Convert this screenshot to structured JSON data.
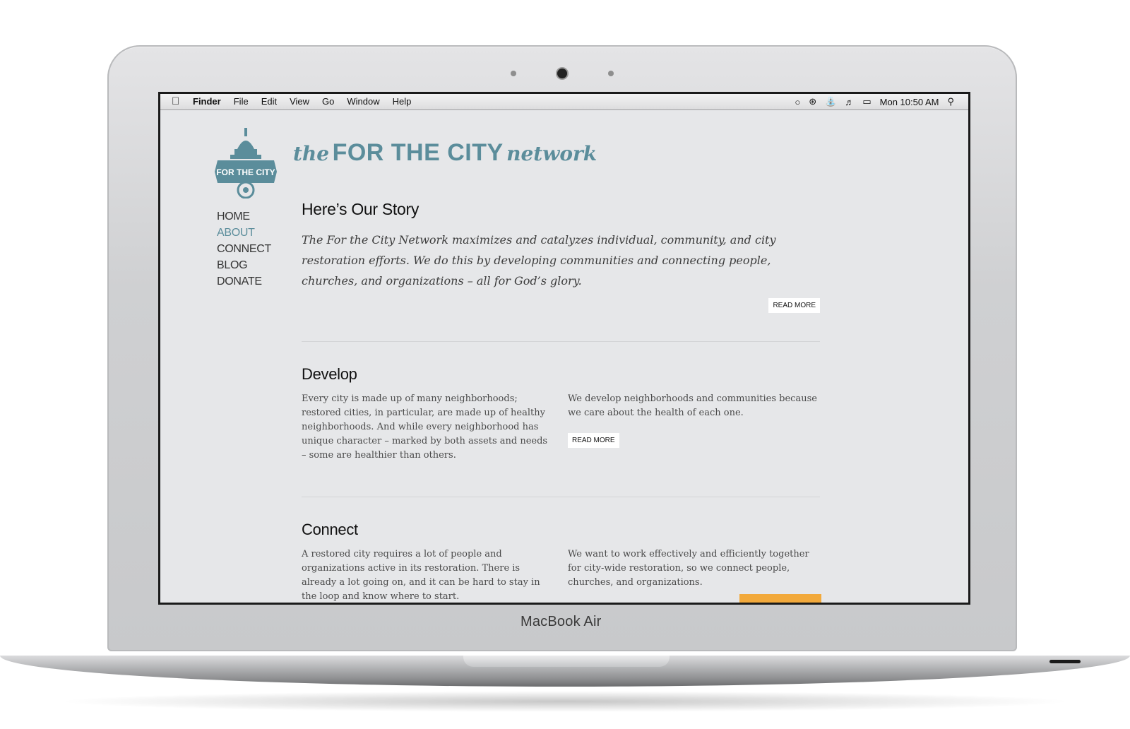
{
  "menubar": {
    "apple_icon": "apple-logo-icon",
    "items": [
      "Finder",
      "File",
      "Edit",
      "View",
      "Go",
      "Window",
      "Help"
    ],
    "clock": "Mon 10:50 AM",
    "status_icons": [
      "chat-bubble-icon",
      "bluetooth-icon",
      "wifi-icon",
      "volume-icon",
      "battery-icon",
      "spotlight-search-icon"
    ]
  },
  "logo": {
    "badge_text": "FOR THE CITY",
    "brand_the": "the",
    "brand_main": "FOR THE CITY",
    "brand_network": "network",
    "color": "#5b8d9b"
  },
  "nav": [
    "HOME",
    "ABOUT",
    "CONNECT",
    "BLOG",
    "DONATE"
  ],
  "nav_active": "ABOUT",
  "story": {
    "heading": "Here’s Our Story",
    "text": "The For the City Network maximizes and catalyzes individual, community, and city restoration efforts. We do this by developing communities and connecting people, churches, and organizations – all for God’s glory.",
    "button": "READ MORE"
  },
  "develop": {
    "heading": "Develop",
    "left": "Every city is made up of many neighborhoods; restored cities, in particular, are made up of healthy neighborhoods. And while every neighborhood has unique character – marked by both assets and needs – some are healthier than others.",
    "right": "We develop neighborhoods and communities because we care about the health of each one.",
    "button": "READ MORE"
  },
  "connect": {
    "heading": "Connect",
    "left": "A restored city requires a lot of people and organizations active in its restoration. There is already a lot going on, and it can be hard to stay in the loop and know where to start.",
    "right": "We want to work effectively and efficiently together for city-wide restoration, so we connect people, churches, and organizations.",
    "accent": "#f2a93b"
  },
  "device": {
    "label": "MacBook Air"
  }
}
